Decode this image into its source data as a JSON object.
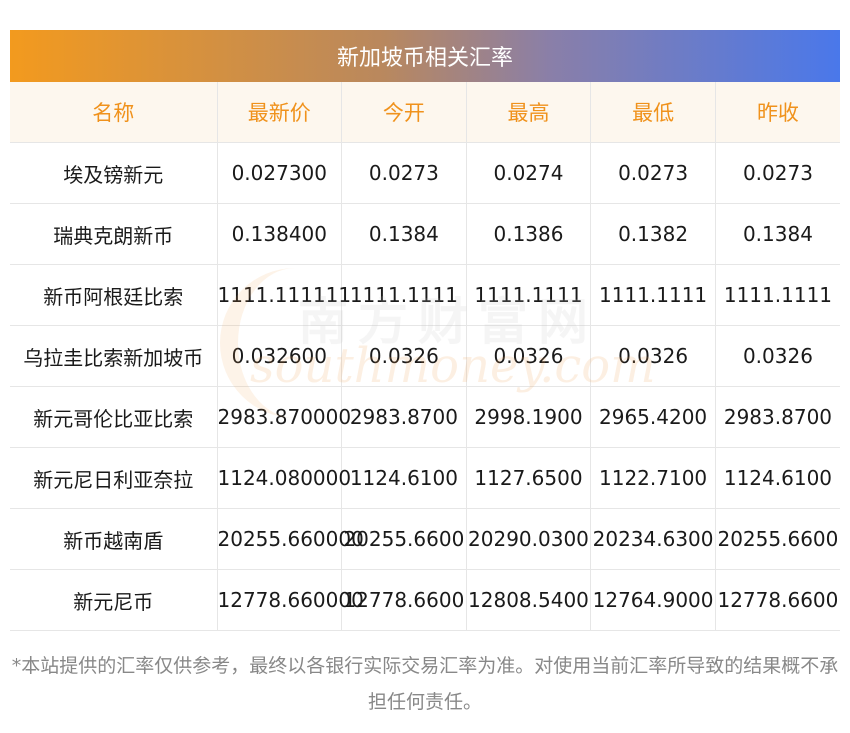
{
  "title": "新加坡币相关汇率",
  "headers": [
    "名称",
    "最新价",
    "今开",
    "最高",
    "最低",
    "昨收"
  ],
  "rows": [
    [
      "埃及镑新元",
      "0.027300",
      "0.0273",
      "0.0274",
      "0.0273",
      "0.0273"
    ],
    [
      "瑞典克朗新币",
      "0.138400",
      "0.1384",
      "0.1386",
      "0.1382",
      "0.1384"
    ],
    [
      "新币阿根廷比索",
      "1111.111111",
      "1111.1111",
      "1111.1111",
      "1111.1111",
      "1111.1111"
    ],
    [
      "乌拉圭比索新加坡币",
      "0.032600",
      "0.0326",
      "0.0326",
      "0.0326",
      "0.0326"
    ],
    [
      "新元哥伦比亚比索",
      "2983.870000",
      "2983.8700",
      "2998.1900",
      "2965.4200",
      "2983.8700"
    ],
    [
      "新元尼日利亚奈拉",
      "1124.080000",
      "1124.6100",
      "1127.6500",
      "1122.7100",
      "1124.6100"
    ],
    [
      "新币越南盾",
      "20255.660000",
      "20255.6600",
      "20290.0300",
      "20234.6300",
      "20255.6600"
    ],
    [
      "新元尼币",
      "12778.660000",
      "12778.6600",
      "12808.5400",
      "12764.9000",
      "12778.6600"
    ]
  ],
  "watermark": {
    "cn": "南方财富网",
    "en": "southmoney.com"
  },
  "footnote": "*本站提供的汇率仅供参考，最终以各银行实际交易汇率为准。对使用当前汇率所导致的结果概不承担任何责任。",
  "colors": {
    "header_text": "#f0921c",
    "header_bg": "#fdf7ee",
    "title_gradient_start": "#f39a1e",
    "title_gradient_end": "#4a78ea"
  }
}
